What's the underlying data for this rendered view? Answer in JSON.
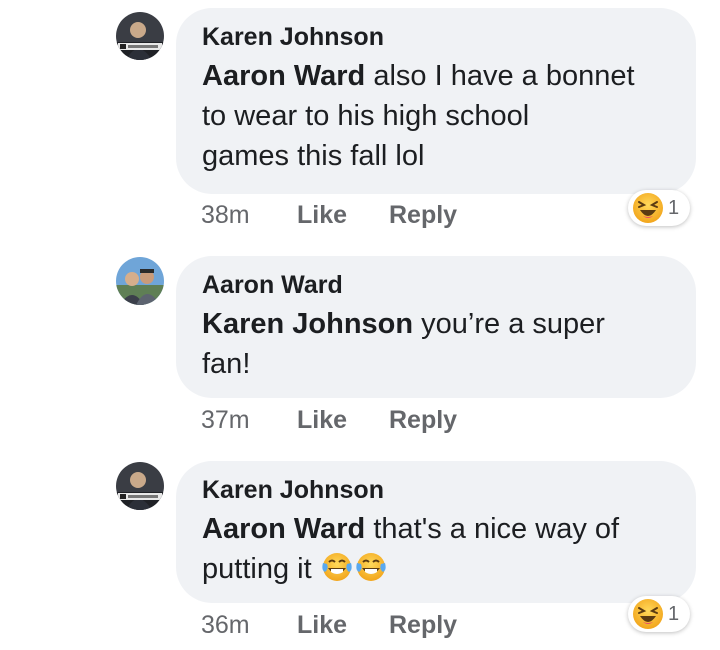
{
  "comments": [
    {
      "author": "Karen Johnson",
      "mention": "Aaron Ward",
      "text_line1": " also I have a bonnet",
      "text_line2": "to wear to his high school",
      "text_line3": "games this fall lol",
      "time": "38m",
      "like": "Like",
      "reply": "Reply",
      "reaction": {
        "icon": "laughing-emoji-icon",
        "count": "1"
      }
    },
    {
      "author": "Aaron Ward",
      "mention": "Karen Johnson",
      "text_line1": " you’re a super",
      "text_line2": "fan!",
      "time": "37m",
      "like": "Like",
      "reply": "Reply"
    },
    {
      "author": "Karen Johnson",
      "mention": "Aaron Ward",
      "text_line1": " that's a nice way of",
      "text_line2": "putting it",
      "emojis": [
        "tears-of-joy-emoji-icon",
        "tears-of-joy-emoji-icon"
      ],
      "time": "36m",
      "like": "Like",
      "reply": "Reply",
      "reaction": {
        "icon": "laughing-emoji-icon",
        "count": "1"
      }
    }
  ],
  "colors": {
    "bubble": "#f0f2f5",
    "text": "#1c1e21",
    "meta": "#65676b",
    "emoji": "#f7b125"
  }
}
